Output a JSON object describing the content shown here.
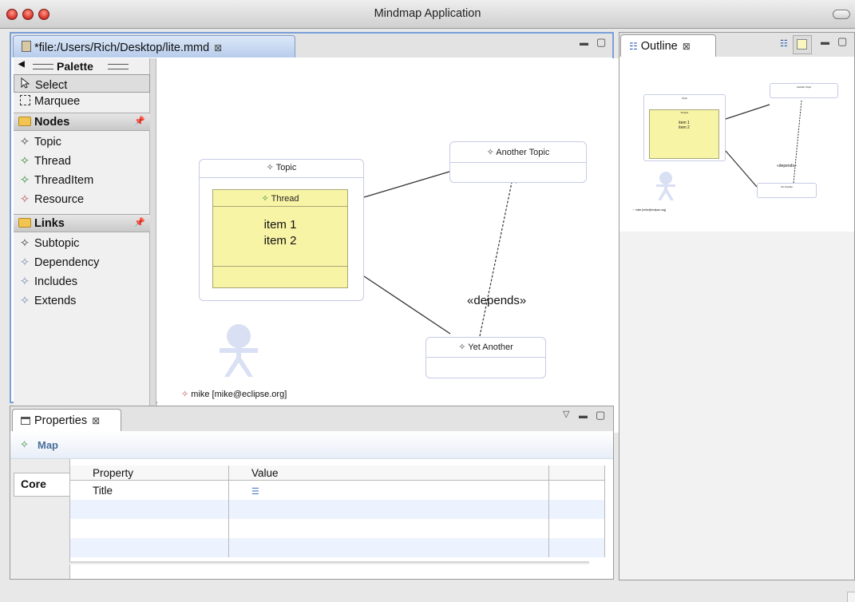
{
  "window": {
    "title": "Mindmap Application"
  },
  "editor": {
    "tab_label": "*file:/Users/Rich/Desktop/lite.mmd",
    "close_glyph": "⊠",
    "minimize_glyph": "▭",
    "maximize_glyph": "▢"
  },
  "palette": {
    "title": "Palette",
    "tools": [
      {
        "label": "Select",
        "icon": "arrow-cursor-icon"
      },
      {
        "label": "Marquee",
        "icon": "marquee-icon"
      }
    ],
    "drawers": [
      {
        "label": "Nodes",
        "items": [
          "Topic",
          "Thread",
          "ThreadItem",
          "Resource"
        ]
      },
      {
        "label": "Links",
        "items": [
          "Subtopic",
          "Dependency",
          "Includes",
          "Extends"
        ]
      }
    ]
  },
  "diagram": {
    "topic": {
      "title": "Topic"
    },
    "thread": {
      "title": "Thread",
      "items": [
        "item 1",
        "item 2"
      ]
    },
    "another": {
      "title": "Another Topic"
    },
    "yet": {
      "title": "Yet Another"
    },
    "dependency_label": "«depends»",
    "resource": {
      "label": "mike [mike@eclipse.org]"
    }
  },
  "outline": {
    "tab_label": "Outline",
    "mini_labels": [
      "Topic",
      "Thread",
      "item 1",
      "item 2",
      "Another Topic",
      "«depends»",
      "Yet Another",
      "mike [mike@eclipse.org]"
    ]
  },
  "properties": {
    "tab_label": "Properties",
    "header": "Map",
    "category_tab": "Core",
    "columns": [
      "Property",
      "Value"
    ],
    "rows": [
      {
        "property": "Title",
        "value": ""
      }
    ]
  },
  "colors": {
    "accent_blue": "#7aa0d8",
    "thread_yellow": "#f8f4a6",
    "shape_border": "#c7cbe6",
    "node_icon_green": "#3a8a3a",
    "resource_icon_red": "#c0555f"
  }
}
